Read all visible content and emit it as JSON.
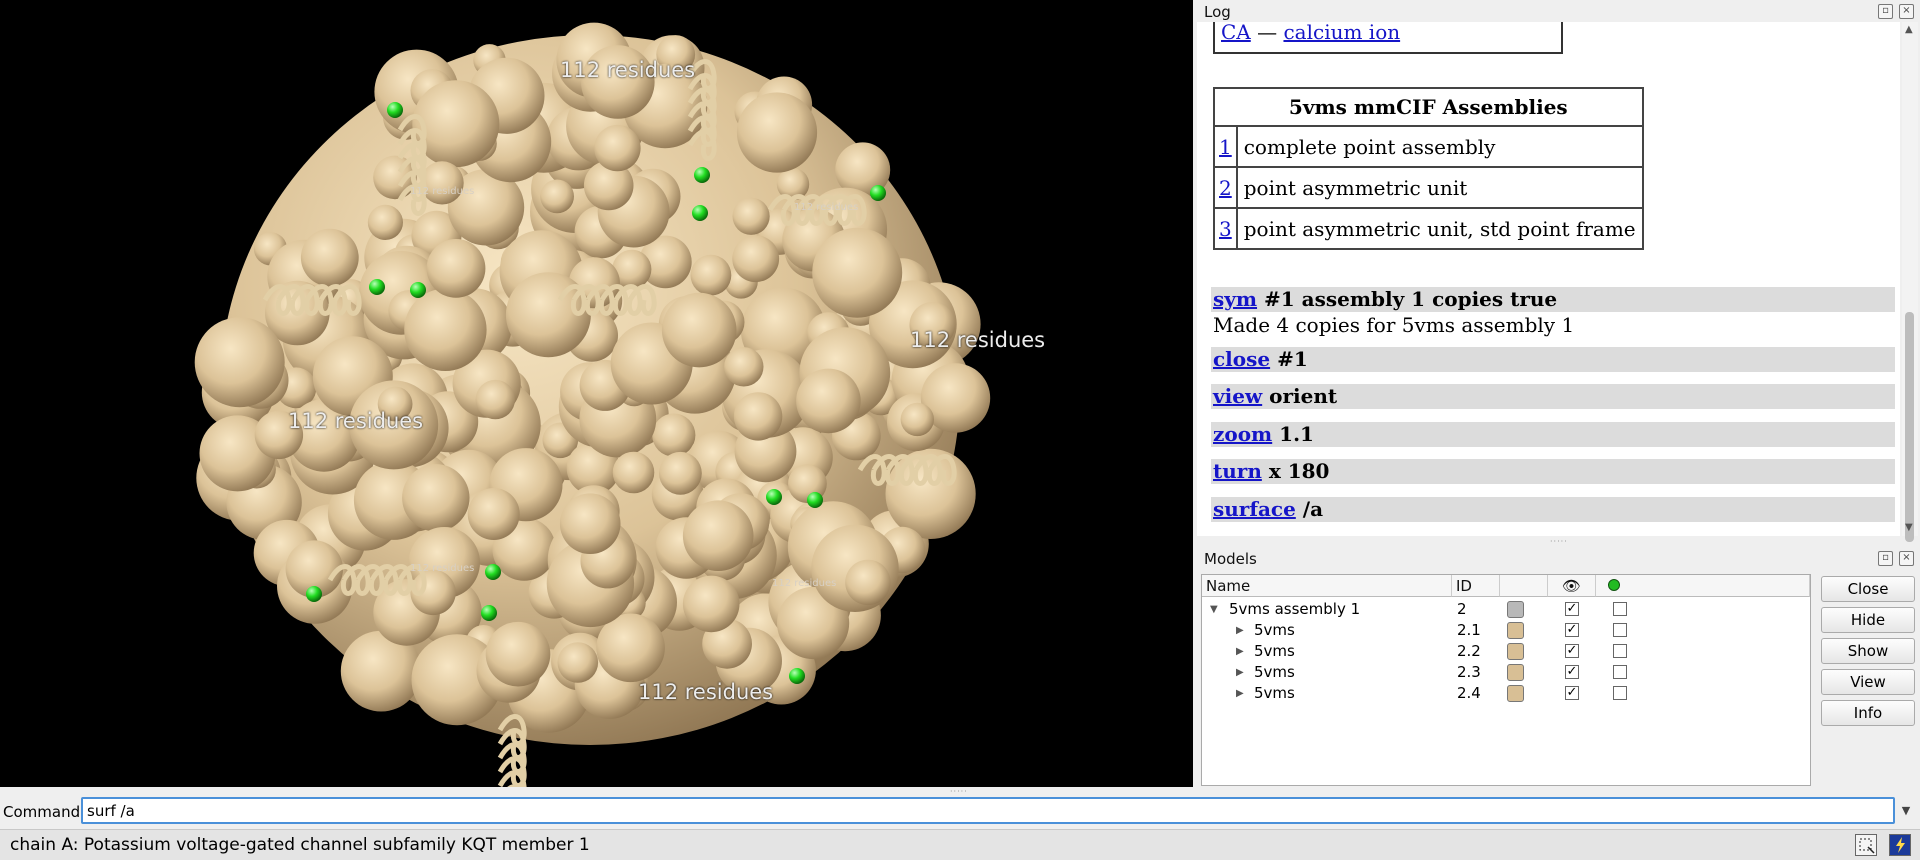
{
  "viewport": {
    "labels": [
      "112 residues",
      "112 residues",
      "112 residues",
      "112 residues"
    ],
    "small_labels": [
      "112 residues",
      "112 residues",
      "112 residues",
      "112 residues"
    ],
    "colors": {
      "surface": "#d8bf95",
      "ion": "#22dd22",
      "background": "#000000"
    }
  },
  "log": {
    "title": "Log",
    "ca_row": {
      "code": "CA",
      "dash": "—",
      "name": "calcium ion"
    },
    "assemblies": {
      "header": "5vms mmCIF Assemblies",
      "rows": [
        {
          "id": "1",
          "desc": "complete point assembly"
        },
        {
          "id": "2",
          "desc": "point asymmetric unit"
        },
        {
          "id": "3",
          "desc": "point asymmetric unit, std point frame"
        }
      ]
    },
    "commands": [
      {
        "cmd": "sym",
        "args": "#1 assembly 1 copies true"
      },
      {
        "cmd": "close",
        "args": "#1"
      },
      {
        "cmd": "view",
        "args": "orient"
      },
      {
        "cmd": "zoom",
        "args": "1.1"
      },
      {
        "cmd": "turn",
        "args": "x 180"
      },
      {
        "cmd": "surface",
        "args": "/a"
      }
    ],
    "output": "Made 4 copies for 5vms assembly 1"
  },
  "models": {
    "title": "Models",
    "headers": {
      "name": "Name",
      "id": "ID"
    },
    "rows": [
      {
        "name": "5vms assembly 1",
        "id": "2",
        "color": "#b8b8b8",
        "shown": "✓"
      },
      {
        "name": "5vms",
        "id": "2.1",
        "color": "#d8bf95",
        "shown": "✓"
      },
      {
        "name": "5vms",
        "id": "2.2",
        "color": "#d8bf95",
        "shown": "✓"
      },
      {
        "name": "5vms",
        "id": "2.3",
        "color": "#d8bf95",
        "shown": "✓"
      },
      {
        "name": "5vms",
        "id": "2.4",
        "color": "#d8bf95",
        "shown": "✓"
      }
    ],
    "buttons": [
      "Close",
      "Hide",
      "Show",
      "View",
      "Info"
    ]
  },
  "command": {
    "label": "Command:",
    "value": "surf /a"
  },
  "status": "chain A: Potassium voltage-gated channel subfamily KQT member 1"
}
